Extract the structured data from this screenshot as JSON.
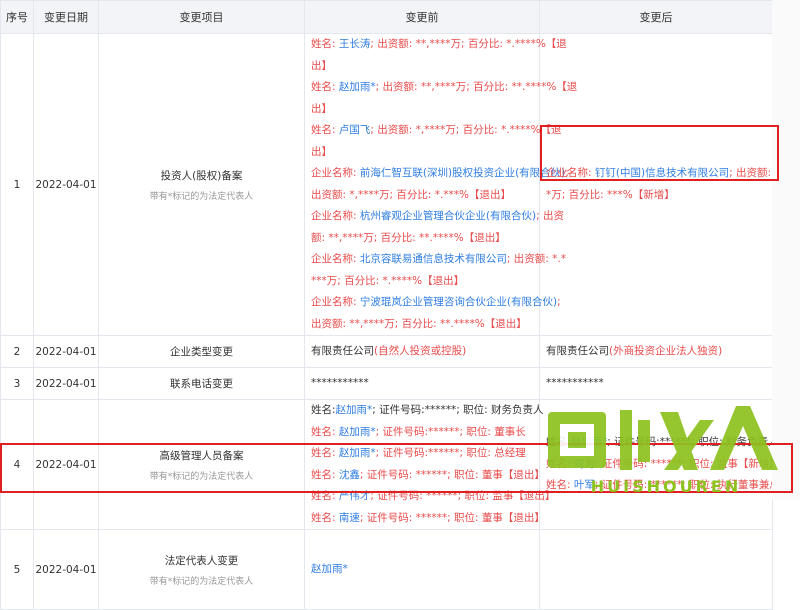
{
  "headers": {
    "index": "序号",
    "date": "变更日期",
    "item": "变更项目",
    "before": "变更前",
    "after": "变更后"
  },
  "rows": [
    {
      "index": "1",
      "date": "2022-04-01",
      "item": "投资人(股权)备案",
      "note": "带有*标记的为法定代表人",
      "before": [
        [
          {
            "t": "姓名: ",
            "c": "red"
          },
          {
            "t": "王长涛",
            "c": "blue"
          },
          {
            "t": "; 出资额: **,****万; 百分比: *.****%【退",
            "c": "red"
          }
        ],
        [
          {
            "t": "出】",
            "c": "red"
          }
        ],
        [
          {
            "t": "姓名: ",
            "c": "red"
          },
          {
            "t": "赵加雨*",
            "c": "blue"
          },
          {
            "t": "; 出资额: **,****万; 百分比: **.****%【退",
            "c": "red"
          }
        ],
        [
          {
            "t": "出】",
            "c": "red"
          }
        ],
        [
          {
            "t": "姓名: ",
            "c": "red"
          },
          {
            "t": "卢国飞",
            "c": "blue"
          },
          {
            "t": "; 出资额: *,****万; 百分比: *.****%【退",
            "c": "red"
          }
        ],
        [
          {
            "t": "出】",
            "c": "red"
          }
        ],
        [
          {
            "t": "企业名称: ",
            "c": "red"
          },
          {
            "t": "前海仁智互联(深圳)股权投资企业(有限合伙)",
            "c": "blue"
          },
          {
            "t": ";",
            "c": "red"
          }
        ],
        [
          {
            "t": "出资额: *,****万; 百分比: *.***%【退出】",
            "c": "red"
          }
        ],
        [
          {
            "t": "企业名称: ",
            "c": "red"
          },
          {
            "t": "杭州睿观企业管理合伙企业(有限合伙)",
            "c": "blue"
          },
          {
            "t": "; 出资",
            "c": "red"
          }
        ],
        [
          {
            "t": "额: **,****万; 百分比: **.****%【退出】",
            "c": "red"
          }
        ],
        [
          {
            "t": "企业名称: ",
            "c": "red"
          },
          {
            "t": "北京容联易通信息技术有限公司",
            "c": "blue"
          },
          {
            "t": "; 出资额: *.*",
            "c": "red"
          }
        ],
        [
          {
            "t": "***万; 百分比: *.****%【退出】",
            "c": "red"
          }
        ],
        [
          {
            "t": "企业名称: ",
            "c": "red"
          },
          {
            "t": "宁波琨岚企业管理咨询合伙企业(有限合伙)",
            "c": "blue"
          },
          {
            "t": ";",
            "c": "red"
          }
        ],
        [
          {
            "t": "出资额: **,****万; 百分比: **.****%【退出】",
            "c": "red"
          }
        ]
      ],
      "after": [
        [
          {
            "t": "企业名称: ",
            "c": "red"
          },
          {
            "t": "钉钉(中国)信息技术有限公司",
            "c": "blue"
          },
          {
            "t": "; 出资额: ***.**",
            "c": "red"
          }
        ],
        [
          {
            "t": "*万; 百分比: ***%【新增】",
            "c": "red"
          }
        ]
      ]
    },
    {
      "index": "2",
      "date": "2022-04-01",
      "item": "企业类型变更",
      "note": "",
      "before": [
        [
          {
            "t": "有限责任公司",
            "c": ""
          },
          {
            "t": "(自然人投资或控股)",
            "c": "red"
          }
        ]
      ],
      "after": [
        [
          {
            "t": "有限责任公司",
            "c": ""
          },
          {
            "t": "(外商投资企业法人独资)",
            "c": "red"
          }
        ]
      ]
    },
    {
      "index": "3",
      "date": "2022-04-01",
      "item": "联系电话变更",
      "note": "",
      "before": [
        [
          {
            "t": "***********",
            "c": ""
          }
        ]
      ],
      "after": [
        [
          {
            "t": "***********",
            "c": ""
          }
        ]
      ]
    },
    {
      "index": "4",
      "date": "2022-04-01",
      "item": "高级管理人员备案",
      "note": "带有*标记的为法定代表人",
      "before": [
        [
          {
            "t": "姓名:",
            "c": ""
          },
          {
            "t": "赵加雨*",
            "c": "blue"
          },
          {
            "t": "; 证件号码:******; 职位: 财务负责人",
            "c": ""
          }
        ],
        [
          {
            "t": "姓名: ",
            "c": "red"
          },
          {
            "t": "赵加雨*",
            "c": "blue"
          },
          {
            "t": "; 证件号码:******; 职位: 董事长",
            "c": "red"
          }
        ],
        [
          {
            "t": "姓名: ",
            "c": "red"
          },
          {
            "t": "赵加雨*",
            "c": "blue"
          },
          {
            "t": "; 证件号码:******; 职位: 总经理",
            "c": "red"
          }
        ],
        [
          {
            "t": "姓名: ",
            "c": "red"
          },
          {
            "t": "沈鑫",
            "c": "blue"
          },
          {
            "t": "; 证件号码: ******; 职位: 董事【退出】",
            "c": "red"
          }
        ],
        [
          {
            "t": "姓名: ",
            "c": "red"
          },
          {
            "t": "严伟才",
            "c": "blue"
          },
          {
            "t": "; 证件号码: ******; 职位: 监事【退出】",
            "c": "red"
          }
        ],
        [
          {
            "t": "姓名: ",
            "c": "red"
          },
          {
            "t": "南速",
            "c": "blue"
          },
          {
            "t": "; 证件号码: ******; 职位: 董事【退出】",
            "c": "red"
          }
        ]
      ],
      "after": [
        [
          {
            "t": "姓名:",
            "c": ""
          },
          {
            "t": "赵加雨*",
            "c": "blue"
          },
          {
            "t": "; 证件号码:******; 职位: 财务负责人",
            "c": ""
          }
        ],
        [
          {
            "t": "姓名: ",
            "c": "red"
          },
          {
            "t": "司为",
            "c": "blue"
          },
          {
            "t": "; 证件号码: ******; 职位: 监事【新增】",
            "c": "red"
          }
        ],
        [
          {
            "t": "姓名: ",
            "c": "red"
          },
          {
            "t": "叶军",
            "c": "blue"
          },
          {
            "t": "; 证件号码: ******; 职位: 执行董事兼总经理",
            "c": "red"
          }
        ]
      ]
    },
    {
      "index": "5",
      "date": "2022-04-01",
      "item": "法定代表人变更",
      "note": "带有*标记的为法定代表人",
      "before": [
        [
          {
            "t": "赵加雨*",
            "c": "blue"
          }
        ]
      ],
      "after": []
    }
  ],
  "watermark": {
    "logo": "回收人",
    "domain": "HUISHOUREN"
  },
  "colors": {
    "red": "#e84b4b",
    "blue": "#2f7de1",
    "header_bg": "#f2f4f7",
    "highlight": "#e02020",
    "watermark": "#8dc21f"
  }
}
